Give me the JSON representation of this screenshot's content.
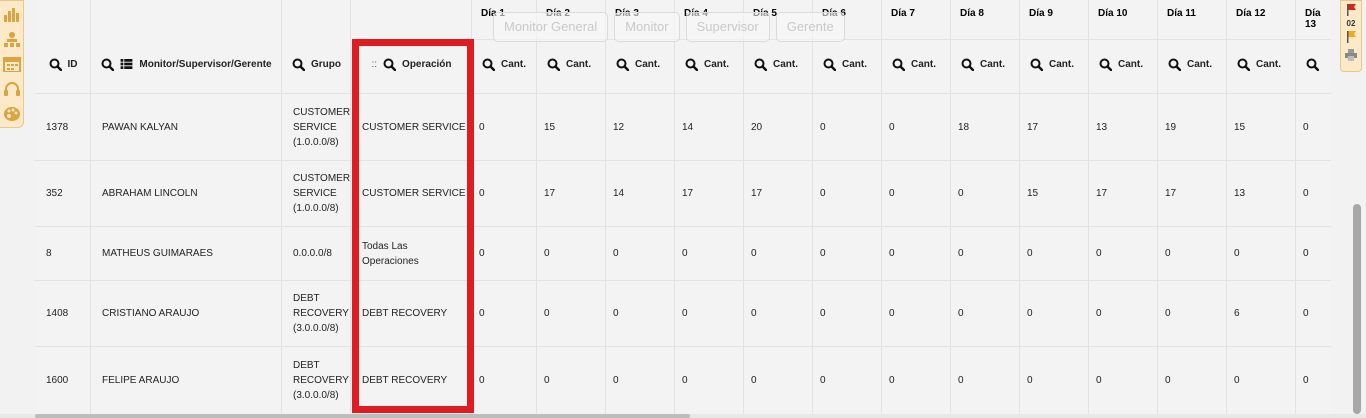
{
  "tabs": [
    "Monitor General",
    "Monitor",
    "Supervisor",
    "Gerente"
  ],
  "headers": {
    "id": "ID",
    "name": "Monitor/Supervisor/Gerente",
    "group": "Grupo",
    "operation": "Operación",
    "drag_handle": "::",
    "cant": "Cant."
  },
  "days": [
    "Día 1",
    "Día 2",
    "Día 3",
    "Día 4",
    "Día 5",
    "Día 6",
    "Día 7",
    "Día 8",
    "Día 9",
    "Día 10",
    "Día 11",
    "Día 12",
    "Día 13"
  ],
  "rows": [
    {
      "id": "1378",
      "name": "PAWAN KALYAN",
      "group": [
        "CUSTOMER",
        "SERVICE",
        "(1.0.0.0/8)"
      ],
      "operation": [
        "CUSTOMER SERVICE"
      ],
      "values": [
        "0",
        "15",
        "12",
        "14",
        "20",
        "0",
        "0",
        "18",
        "17",
        "13",
        "19",
        "15",
        "0"
      ]
    },
    {
      "id": "352",
      "name": "ABRAHAM LINCOLN",
      "group": [
        "CUSTOMER",
        "SERVICE",
        "(1.0.0.0/8)"
      ],
      "operation": [
        "CUSTOMER SERVICE"
      ],
      "values": [
        "0",
        "17",
        "14",
        "17",
        "17",
        "0",
        "0",
        "0",
        "15",
        "17",
        "17",
        "13",
        "0"
      ]
    },
    {
      "id": "8",
      "name": "MATHEUS GUIMARAES",
      "group": [
        "0.0.0.0/8"
      ],
      "operation": [
        "Todas Las",
        "Operaciones"
      ],
      "values": [
        "0",
        "0",
        "0",
        "0",
        "0",
        "0",
        "0",
        "0",
        "0",
        "0",
        "0",
        "0",
        "0"
      ]
    },
    {
      "id": "1408",
      "name": "CRISTIANO ARAUJO",
      "group": [
        "DEBT",
        "RECOVERY",
        "(3.0.0.0/8)"
      ],
      "operation": [
        "DEBT RECOVERY"
      ],
      "values": [
        "0",
        "0",
        "0",
        "0",
        "0",
        "0",
        "0",
        "0",
        "0",
        "0",
        "0",
        "6",
        "0"
      ]
    },
    {
      "id": "1600",
      "name": "FELIPE ARAUJO",
      "group": [
        "DEBT",
        "RECOVERY",
        "(3.0.0.0/8)"
      ],
      "operation": [
        "DEBT RECOVERY"
      ],
      "values": [
        "0",
        "0",
        "0",
        "0",
        "0",
        "0",
        "0",
        "0",
        "0",
        "0",
        "0",
        "0",
        "0"
      ]
    }
  ],
  "right_toolbar": {
    "badge": "02"
  },
  "colors": {
    "highlight": "#e11b22",
    "toolbar_bg": "#fbe9c7",
    "toolbar_icon": "#d9a441",
    "flag_red": "#d9241c",
    "flag_orange": "#f0a91d"
  },
  "left_toolbar_icons": [
    "bar-chart-icon",
    "org-chart-icon",
    "calendar-icon",
    "headset-icon",
    "palette-icon"
  ],
  "right_toolbar_icons": [
    "red-flag-icon",
    "orange-flag-icon",
    "print-icon"
  ]
}
